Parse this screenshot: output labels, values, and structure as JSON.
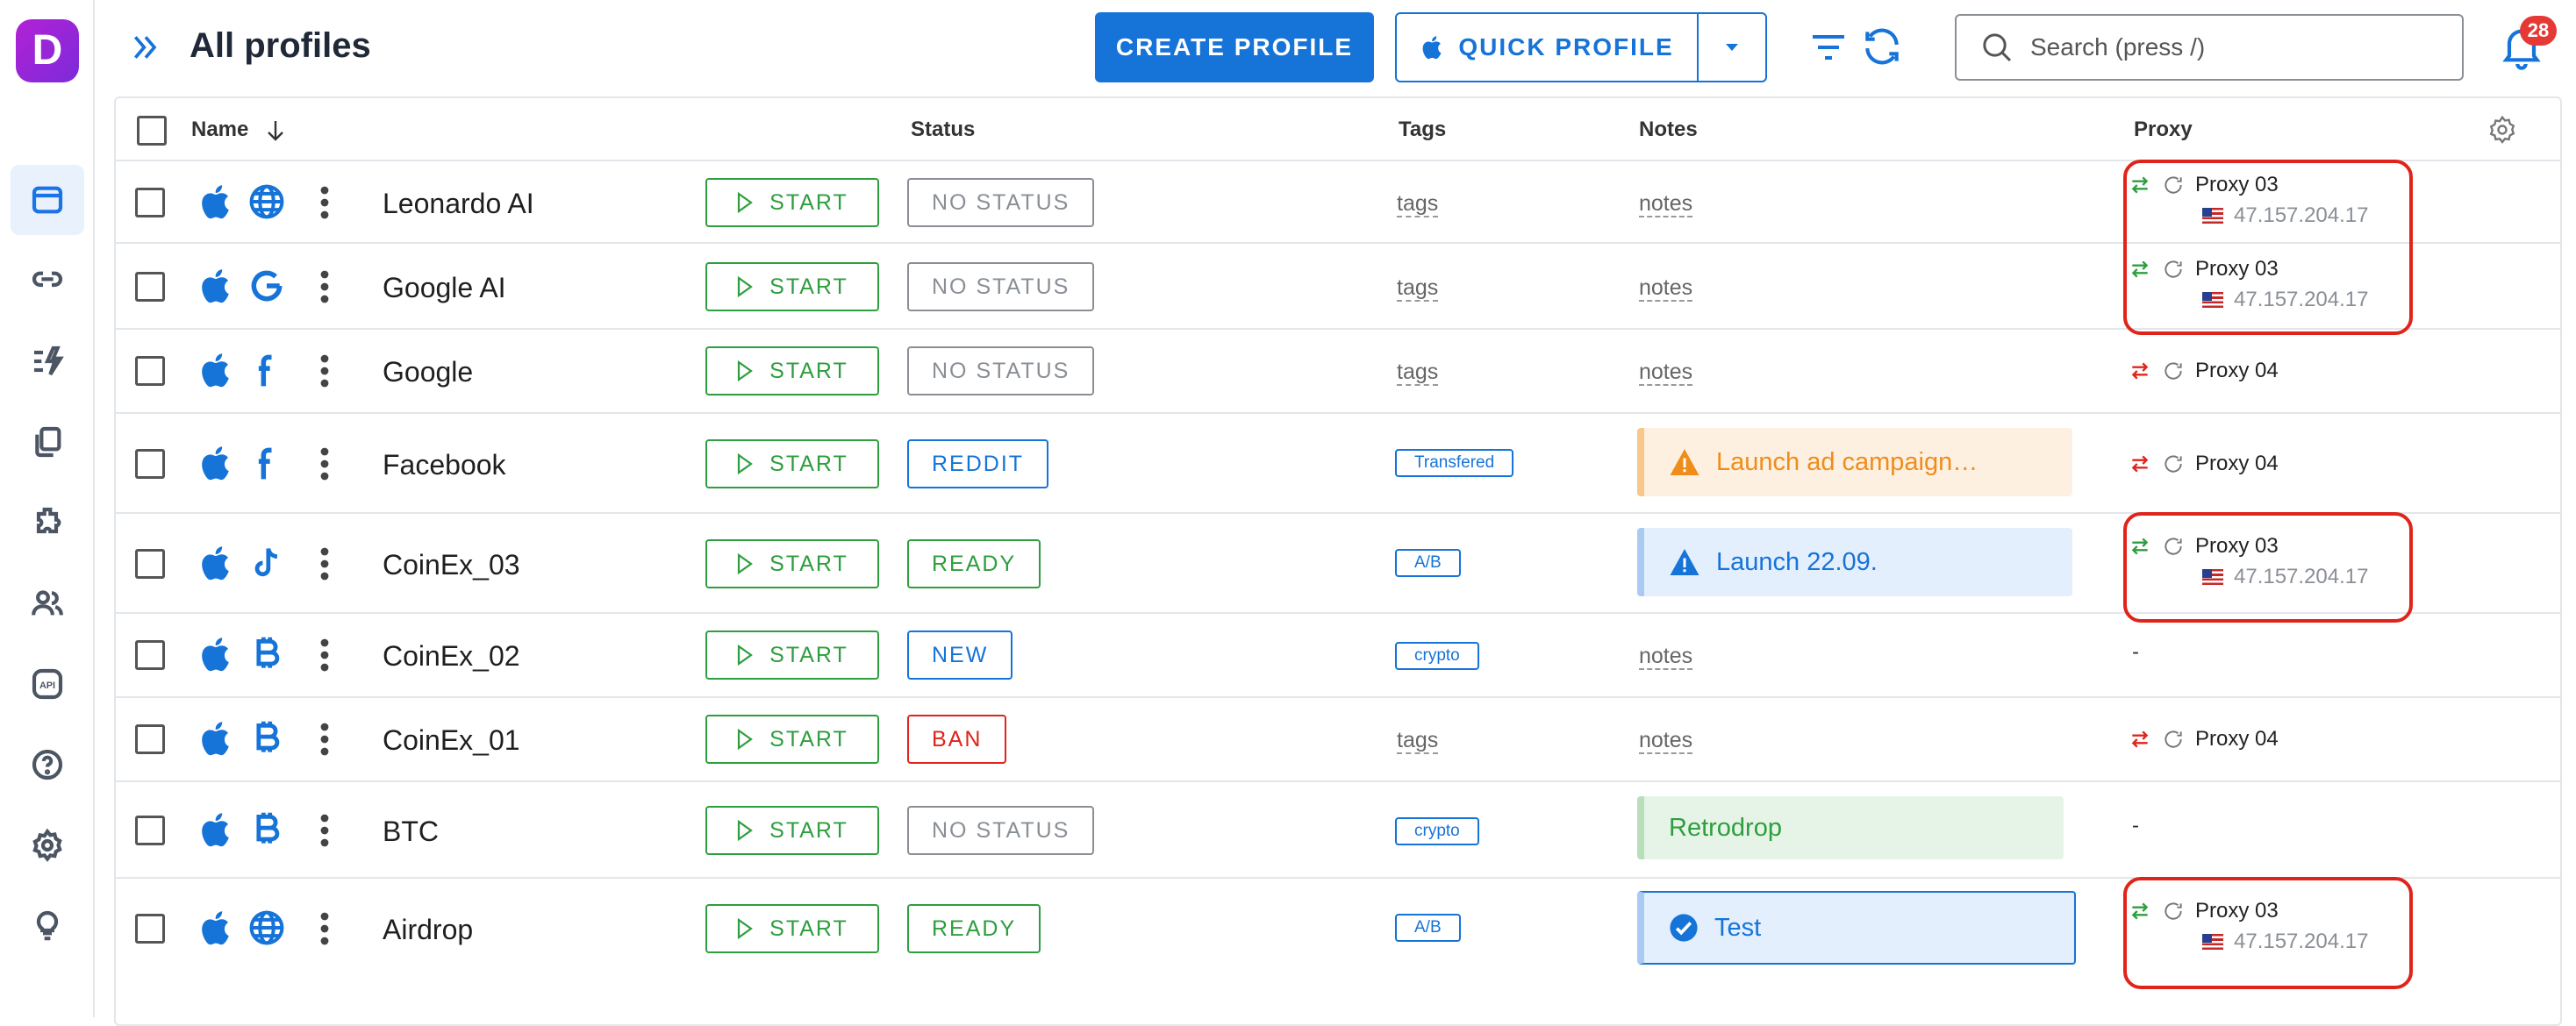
{
  "app": {
    "logo_letter": "D",
    "page_title": "All profiles"
  },
  "sidebar": {
    "items": [
      {
        "name": "profiles",
        "icon": "browser-window-icon",
        "active": true
      },
      {
        "name": "proxies",
        "icon": "link-icon"
      },
      {
        "name": "automation",
        "icon": "lightning-list-icon"
      },
      {
        "name": "templates",
        "icon": "copy-icon"
      },
      {
        "name": "extensions",
        "icon": "puzzle-icon"
      },
      {
        "name": "team",
        "icon": "users-icon"
      },
      {
        "name": "api",
        "icon": "api-icon",
        "label": "API"
      },
      {
        "name": "help",
        "icon": "help-icon"
      },
      {
        "name": "settings",
        "icon": "gear-icon"
      },
      {
        "name": "tips",
        "icon": "lightbulb-icon"
      }
    ]
  },
  "toolbar": {
    "create_label": "CREATE PROFILE",
    "quick_label": "QUICK PROFILE",
    "search_placeholder": "Search (press /)",
    "notifications_count": "28"
  },
  "table": {
    "columns": {
      "name": "Name",
      "status": "Status",
      "tags": "Tags",
      "notes": "Notes",
      "proxy": "Proxy"
    },
    "rows": [
      {
        "name": "Leonardo AI",
        "start": "START",
        "status": "NO STATUS",
        "tags": "tags",
        "notes": "notes",
        "proxy": "Proxy 03",
        "ip": "47.157.204.17",
        "icon": "globe-icon"
      },
      {
        "name": "Google AI",
        "start": "START",
        "status": "NO STATUS",
        "tags": "tags",
        "notes": "notes",
        "proxy": "Proxy 03",
        "ip": "47.157.204.17",
        "icon": "google-icon"
      },
      {
        "name": "Google",
        "start": "START",
        "status": "NO STATUS",
        "tags": "tags",
        "notes": "notes",
        "proxy": "Proxy 04",
        "icon": "facebook-icon"
      },
      {
        "name": "Facebook",
        "start": "START",
        "status": "REDDIT",
        "tag_chip": "Transfered",
        "note": "Launch ad campaign…",
        "proxy": "Proxy 04",
        "icon": "facebook-icon"
      },
      {
        "name": "CoinEx_03",
        "start": "START",
        "status": "READY",
        "tag_chip": "A/B",
        "note": "Launch 22.09.",
        "proxy": "Proxy 03",
        "ip": "47.157.204.17",
        "icon": "tiktok-icon"
      },
      {
        "name": "CoinEx_02",
        "start": "START",
        "status": "NEW",
        "tag_chip": "crypto",
        "notes": "notes",
        "proxy": "-",
        "icon": "bitcoin-icon"
      },
      {
        "name": "CoinEx_01",
        "start": "START",
        "status": "BAN",
        "tags": "tags",
        "notes": "notes",
        "proxy": "Proxy 04",
        "icon": "bitcoin-icon"
      },
      {
        "name": "BTC",
        "start": "START",
        "status": "NO STATUS",
        "tag_chip": "crypto",
        "note": "Retrodrop",
        "proxy": "-",
        "icon": "bitcoin-icon"
      },
      {
        "name": "Airdrop",
        "start": "START",
        "status": "READY",
        "tag_chip": "A/B",
        "note": "Test",
        "proxy": "Proxy 03",
        "ip": "47.157.204.17",
        "icon": "globe-icon"
      }
    ]
  },
  "colors": {
    "primary": "#1673d8",
    "green": "#2e9e3e",
    "red": "#e0241b",
    "grey": "#8a8f96",
    "note_orange": "#fdf0e0",
    "note_blue": "#e3effc",
    "note_green": "#e6f4e7"
  }
}
